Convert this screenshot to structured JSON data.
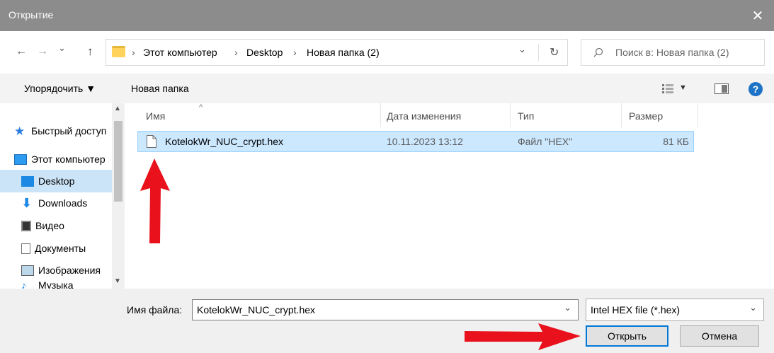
{
  "window": {
    "title": "Открытие",
    "close_glyph": "✕"
  },
  "nav": {
    "back_glyph": "←",
    "forward_glyph": "→",
    "recent_glyph": "⌄",
    "up_glyph": "↑",
    "breadcrumb": [
      "Этот компьютер",
      "Desktop",
      "Новая папка (2)"
    ],
    "sep_glyph": "›",
    "dropdown_glyph": "⌄",
    "refresh_glyph": "↻"
  },
  "search": {
    "placeholder": "Поиск в: Новая папка (2)"
  },
  "toolbar": {
    "organize": "Упорядочить ▼",
    "new_folder": "Новая папка",
    "help_glyph": "?"
  },
  "sidebar": {
    "items": [
      {
        "label": "Быстрый доступ"
      },
      {
        "label": "Этот компьютер"
      },
      {
        "label": "Desktop"
      },
      {
        "label": "Downloads"
      },
      {
        "label": "Видео"
      },
      {
        "label": "Документы"
      },
      {
        "label": "Изображения"
      },
      {
        "label": "Музыка"
      }
    ]
  },
  "columns": {
    "name": "Имя",
    "date": "Дата изменения",
    "type": "Тип",
    "size": "Размер"
  },
  "files": [
    {
      "name": "KotelokWr_NUC_crypt.hex",
      "date": "10.11.2023 13:12",
      "type": "Файл \"HEX\"",
      "size": "81 КБ"
    }
  ],
  "bottom": {
    "filename_label": "Имя файла:",
    "filename_value": "KotelokWr_NUC_crypt.hex",
    "filter_value": "Intel HEX file (*.hex)",
    "open_label": "Открыть",
    "cancel_label": "Отмена"
  },
  "colors": {
    "accent": "#0078d7",
    "selection": "#cce8ff",
    "annotation_arrow": "#e8111c"
  }
}
